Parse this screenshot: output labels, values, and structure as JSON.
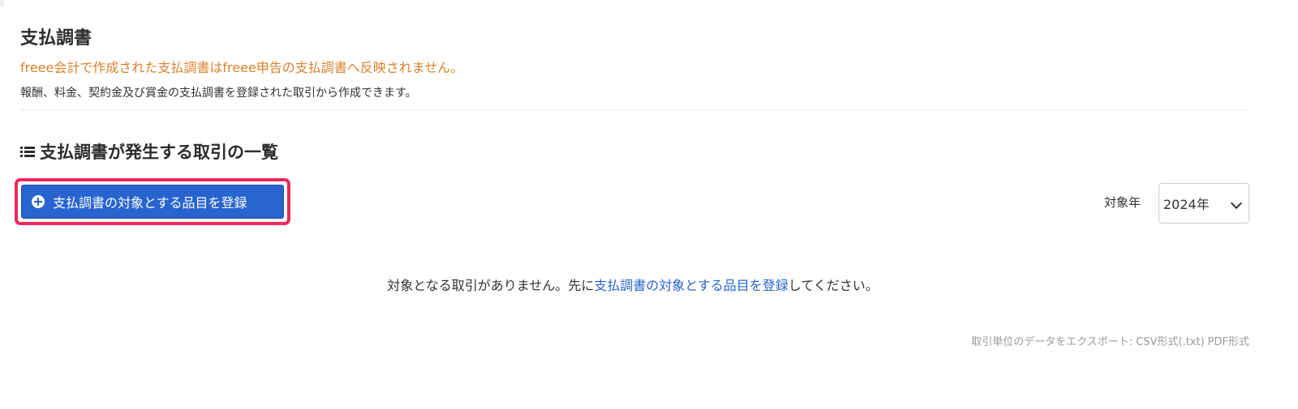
{
  "header": {
    "title": "支払調書",
    "warning": "freee会計で作成された支払調書はfreee申告の支払調書へ反映されません。",
    "description": "報酬、料金、契約金及び賞金の支払調書を登録された取引から作成できます。"
  },
  "section": {
    "title": "支払調書が発生する取引の一覧",
    "icon": "list-icon"
  },
  "toolbar": {
    "register_label": "支払調書の対象とする品目を登録",
    "register_icon": "plus-circle-icon",
    "year_label": "対象年",
    "year_value": "2024年"
  },
  "empty_state": {
    "prefix": "対象となる取引がありません。先に",
    "link": "支払調書の対象とする品目を登録",
    "suffix": "してください。"
  },
  "export": {
    "label": "取引単位のデータをエクスポート:",
    "csv": "CSV形式(.txt)",
    "pdf": "PDF形式"
  },
  "colors": {
    "primary": "#2864cf",
    "warning": "#d9822b",
    "highlight": "#f0285c",
    "muted": "#9a9a9a"
  }
}
